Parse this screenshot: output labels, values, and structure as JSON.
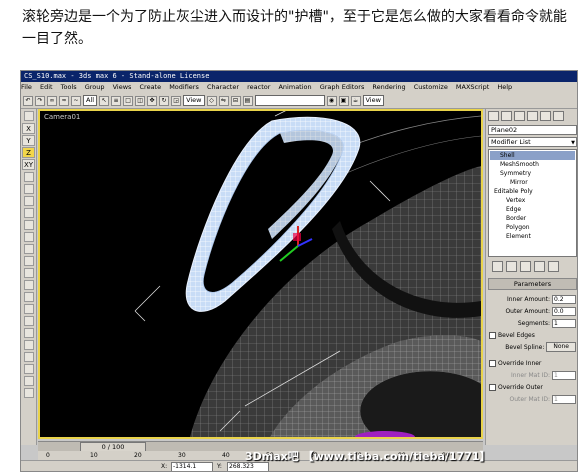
{
  "caption": "滚轮旁边是一个为了防止灰尘进入而设计的\"护槽\"，至于它是怎么做的大家看看命令就能一目了然。",
  "window": {
    "title": "CS_S10.max - 3ds max 6 - Stand-alone License",
    "menus": [
      "File",
      "Edit",
      "Tools",
      "Group",
      "Views",
      "Create",
      "Modifiers",
      "Character",
      "reactor",
      "Animation",
      "Graph Editors",
      "Rendering",
      "Customize",
      "MAXScript",
      "Help"
    ],
    "menus_right": [
      "Rendering",
      "Customize",
      "MAX"
    ]
  },
  "toolbar": {
    "filter_select": "All",
    "view_select": "View",
    "view_select_right": "View"
  },
  "left_axes": [
    "X",
    "Y",
    "Z",
    "XY"
  ],
  "viewport": {
    "label": "Camera01"
  },
  "command_panel": {
    "object_name": "Plane02",
    "modifier_list": "Modifier List",
    "stack": [
      {
        "label": "Shell",
        "indent": 1,
        "selected": true
      },
      {
        "label": "MeshSmooth",
        "indent": 1,
        "selected": false
      },
      {
        "label": "Symmetry",
        "indent": 1,
        "selected": false
      },
      {
        "label": "Mirror",
        "indent": 2,
        "selected": false
      },
      {
        "label": "Editable Poly",
        "indent": 0,
        "selected": false
      },
      {
        "label": "Vertex",
        "indent": 2,
        "selected": false
      },
      {
        "label": "Edge",
        "indent": 2,
        "selected": false
      },
      {
        "label": "Border",
        "indent": 2,
        "selected": false
      },
      {
        "label": "Polygon",
        "indent": 2,
        "selected": false
      },
      {
        "label": "Element",
        "indent": 2,
        "selected": false
      }
    ],
    "parameters_title": "Parameters",
    "inner_amount_label": "Inner Amount:",
    "inner_amount_value": "0.2",
    "outer_amount_label": "Outer Amount:",
    "outer_amount_value": "0.0",
    "segments_label": "Segments:",
    "segments_value": "1",
    "bevel_edges_label": "Bevel Edges",
    "bevel_spline_label": "Bevel Spline:",
    "bevel_spline_button": "None",
    "override_inner_label": "Override Inner",
    "inner_mat_id_label": "Inner Mat ID:",
    "inner_mat_id_value": "1",
    "override_outer_label": "Override Outer",
    "outer_mat_id_label": "Outer Mat ID:",
    "outer_mat_id_value": "1"
  },
  "timeline": {
    "slider": "0 / 100",
    "ruler": [
      "0",
      "10",
      "20",
      "30",
      "40",
      "50",
      "60",
      "70",
      "80",
      "90"
    ]
  },
  "status": {
    "x_label": "X:",
    "x_value": "-1314.1",
    "y_label": "Y:",
    "y_value": "268.323"
  },
  "watermark": "3Dmax吧 【www.tieba.com/tieba/1771】"
}
